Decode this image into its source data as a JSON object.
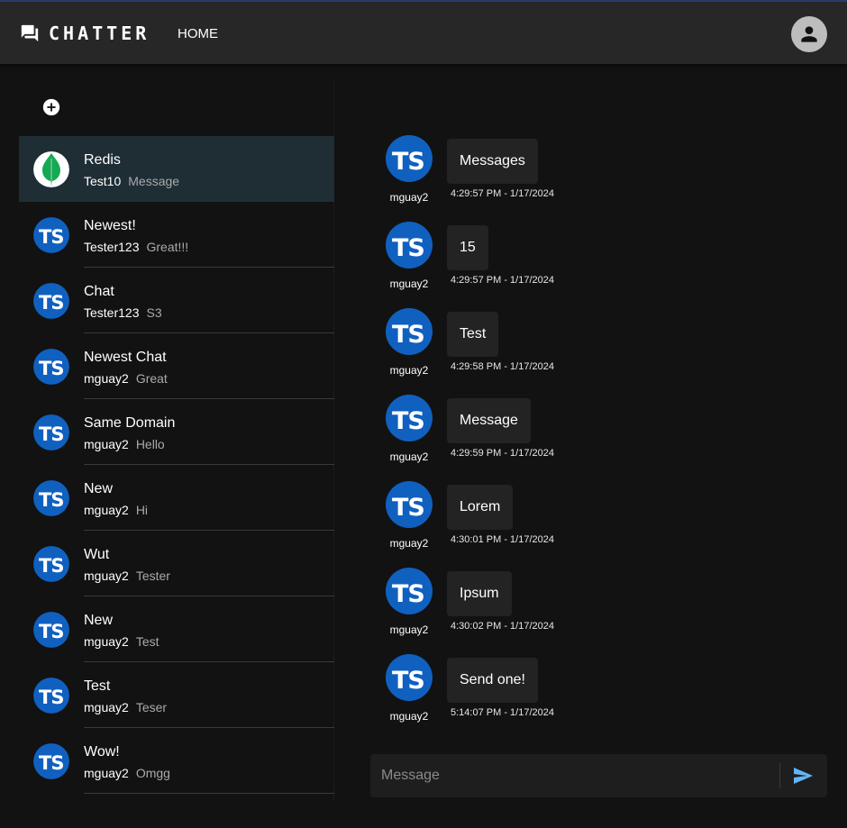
{
  "app": {
    "brand": "CHATTER",
    "nav_home": "HOME"
  },
  "colors": {
    "accent": "#1060c0",
    "selected": "#1f2e35",
    "send": "#64b5f6"
  },
  "sidebar": {
    "chats": [
      {
        "name": "Redis",
        "user": "Test10",
        "last": "Message",
        "avatar": "mongo-leaf",
        "selected": true
      },
      {
        "name": "Newest!",
        "user": "Tester123",
        "last": "Great!!!",
        "avatar": "ts"
      },
      {
        "name": "Chat",
        "user": "Tester123",
        "last": "S3",
        "avatar": "ts"
      },
      {
        "name": "Newest Chat",
        "user": "mguay2",
        "last": "Great",
        "avatar": "ts"
      },
      {
        "name": "Same Domain",
        "user": "mguay2",
        "last": "Hello",
        "avatar": "ts"
      },
      {
        "name": "New",
        "user": "mguay2",
        "last": "Hi",
        "avatar": "ts"
      },
      {
        "name": "Wut",
        "user": "mguay2",
        "last": "Tester",
        "avatar": "ts"
      },
      {
        "name": "New",
        "user": "mguay2",
        "last": "Test",
        "avatar": "ts"
      },
      {
        "name": "Test",
        "user": "mguay2",
        "last": "Teser",
        "avatar": "ts"
      },
      {
        "name": "Wow!",
        "user": "mguay2",
        "last": "Omgg",
        "avatar": "ts"
      }
    ]
  },
  "messages": [
    {
      "user": "mguay2",
      "text": "Messages",
      "time": "4:29:57 PM - 1/17/2024"
    },
    {
      "user": "mguay2",
      "text": "15",
      "time": "4:29:57 PM - 1/17/2024"
    },
    {
      "user": "mguay2",
      "text": "Test",
      "time": "4:29:58 PM - 1/17/2024"
    },
    {
      "user": "mguay2",
      "text": "Message",
      "time": "4:29:59 PM - 1/17/2024"
    },
    {
      "user": "mguay2",
      "text": "Lorem",
      "time": "4:30:01 PM - 1/17/2024"
    },
    {
      "user": "mguay2",
      "text": "Ipsum",
      "time": "4:30:02 PM - 1/17/2024"
    },
    {
      "user": "mguay2",
      "text": "Send one!",
      "time": "5:14:07 PM - 1/17/2024"
    }
  ],
  "composer": {
    "placeholder": "Message"
  }
}
